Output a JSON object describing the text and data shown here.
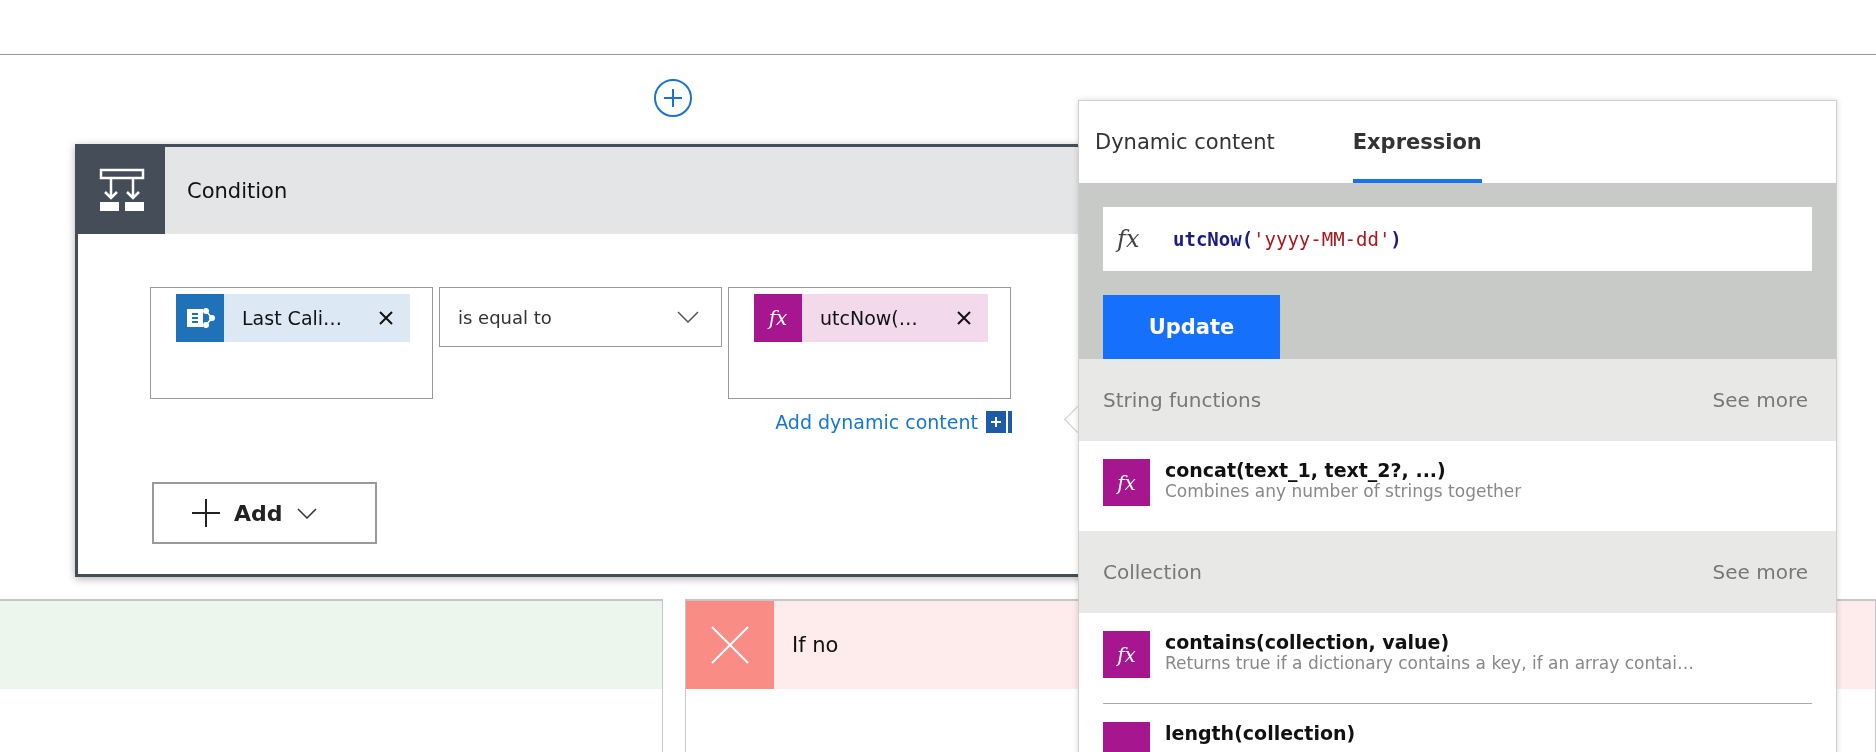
{
  "condition": {
    "title": "Condition",
    "left_token": {
      "kind": "sharepoint",
      "label": "Last Cali…"
    },
    "operator": "is equal to",
    "right_token": {
      "kind": "expression",
      "icon": "fx",
      "label": "utcNow(…"
    },
    "add_dynamic_content": "Add dynamic content",
    "add_button": "Add"
  },
  "branches": [
    {
      "kind": "yes"
    },
    {
      "kind": "no",
      "title": "If no"
    }
  ],
  "panel": {
    "tabs": [
      {
        "label": "Dynamic content",
        "selected": false
      },
      {
        "label": "Expression",
        "selected": true
      }
    ],
    "expression": {
      "icon": "fx",
      "tokens": [
        {
          "kind": "function",
          "text": "utcNow("
        },
        {
          "kind": "string",
          "text": "'yyyy-MM-dd'"
        },
        {
          "kind": "function",
          "text": ")"
        }
      ]
    },
    "update_button": "Update",
    "groups": [
      {
        "title": "String functions",
        "see_more": "See more",
        "items": [
          {
            "icon": "fx",
            "name": "concat(text_1, text_2?, ...)",
            "description": "Combines any number of strings together"
          }
        ]
      },
      {
        "title": "Collection",
        "see_more": "See more",
        "items": [
          {
            "icon": "fx",
            "name": "contains(collection, value)",
            "description": "Returns true if a dictionary contains a key, if an array contai…"
          },
          {
            "name": "length(collection)"
          }
        ]
      }
    ]
  }
}
